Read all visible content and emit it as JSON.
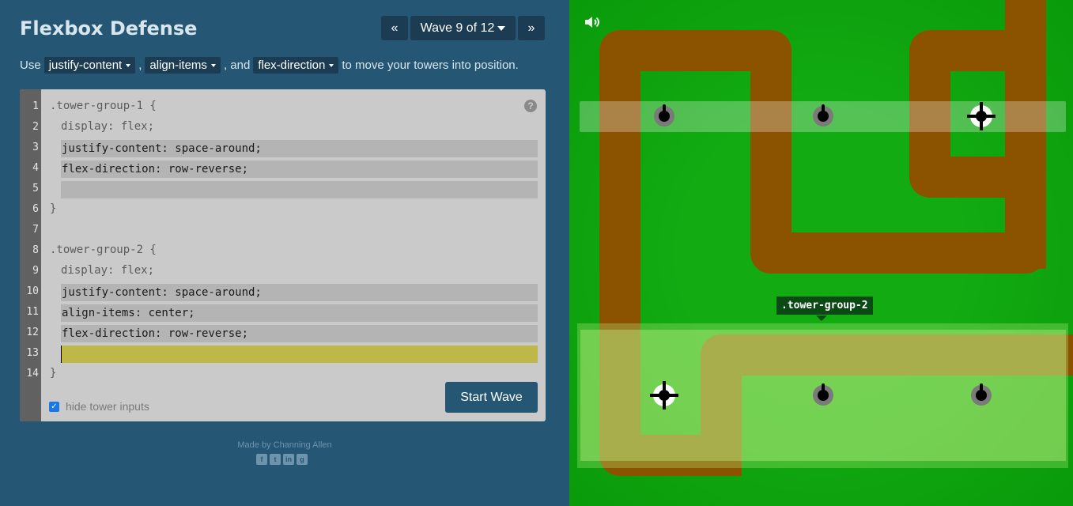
{
  "header": {
    "title": "Flexbox Defense",
    "prev_label": "«",
    "wave_label": "Wave 9 of 12",
    "next_label": "»"
  },
  "instructions": {
    "prefix": "Use",
    "prop1": "justify-content",
    "sep1": ",",
    "prop2": "align-items",
    "sep2": ", and",
    "prop3": "flex-direction",
    "suffix": "to move your towers into position."
  },
  "editor": {
    "line_numbers": [
      "1",
      "2",
      "3",
      "4",
      "5",
      "6",
      "7",
      "8",
      "9",
      "10",
      "11",
      "12",
      "13",
      "14"
    ],
    "g1_selector": ".tower-group-1 {",
    "g1_display": "display: flex;",
    "g1_field1": "justify-content: space-around;",
    "g1_field2": "flex-direction: row-reverse;",
    "g1_field3": "",
    "g1_close": "}",
    "g2_selector": ".tower-group-2 {",
    "g2_display": "display: flex;",
    "g2_field1": "justify-content: space-around;",
    "g2_field2": "align-items: center;",
    "g2_field3": "flex-direction: row-reverse;",
    "g2_field4": "",
    "g2_close": "}",
    "help": "?",
    "hide_label": "hide tower inputs",
    "hide_checked": true,
    "start_label": "Start Wave"
  },
  "footer": {
    "made_by": "Made by Channing Allen",
    "icons": [
      "facebook-icon",
      "twitter-icon",
      "linkedin-icon",
      "github-icon"
    ]
  },
  "board": {
    "tooltip": ".tower-group-2",
    "icons": [
      "sound-icon"
    ],
    "colors": {
      "grass": "#12ab12",
      "path": "#8b5300",
      "group_highlight": "#b0e07a",
      "button": "#255774"
    }
  }
}
